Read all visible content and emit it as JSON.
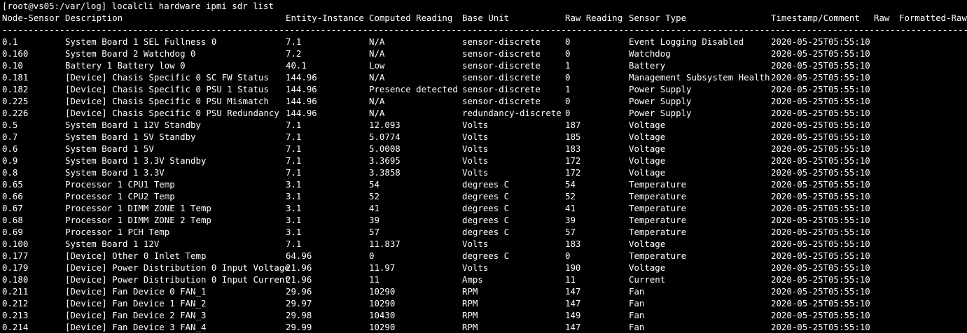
{
  "terminal": {
    "prompt": "[root@vs05:/var/log] localcli hardware ipmi sdr list",
    "headers": [
      "Node-Sensor",
      "Description",
      "Entity-Instance",
      "Computed Reading",
      "Base Unit",
      "Raw Reading",
      "Sensor Type",
      "Timestamp/Comment",
      "Raw",
      "Formatted-Raw"
    ],
    "separator": "----------------------------------------------------------------------------------------------------------------------------------------------------------------------------------------------------------------------------------------------------------",
    "rows": [
      [
        "0.1",
        "System Board 1 SEL Fullness 0",
        "7.1",
        "N/A",
        "sensor-discrete",
        "0",
        "Event Logging Disabled",
        "2020-05-25T05:55:10",
        "",
        ""
      ],
      [
        "0.160",
        "System Board 2 Watchdog 0",
        "7.2",
        "N/A",
        "sensor-discrete",
        "0",
        "Watchdog",
        "2020-05-25T05:55:10",
        "",
        ""
      ],
      [
        "0.10",
        "Battery 1 Battery low 0",
        "40.1",
        "Low",
        "sensor-discrete",
        "1",
        "Battery",
        "2020-05-25T05:55:10",
        "",
        ""
      ],
      [
        "0.181",
        "[Device] Chasis Specific 0 SC FW Status",
        "144.96",
        "N/A",
        "sensor-discrete",
        "0",
        "Management Subsystem Health",
        "2020-05-25T05:55:10",
        "",
        ""
      ],
      [
        "0.182",
        "[Device] Chasis Specific 0 PSU 1 Status",
        "144.96",
        "Presence detected",
        "sensor-discrete",
        "1",
        "Power Supply",
        "2020-05-25T05:55:10",
        "",
        ""
      ],
      [
        "0.225",
        "[Device] Chasis Specific 0 PSU Mismatch",
        "144.96",
        "N/A",
        "sensor-discrete",
        "0",
        "Power Supply",
        "2020-05-25T05:55:10",
        "",
        ""
      ],
      [
        "0.226",
        "[Device] Chasis Specific 0 PSU Redundancy",
        "144.96",
        "N/A",
        "redundancy-discrete",
        "0",
        "Power Supply",
        "2020-05-25T05:55:10",
        "",
        ""
      ],
      [
        "0.5",
        "System Board 1 12V Standby",
        "7.1",
        "12.093",
        "Volts",
        "187",
        "Voltage",
        "2020-05-25T05:55:10",
        "",
        ""
      ],
      [
        "0.7",
        "System Board 1 5V Standby",
        "7.1",
        "5.0774",
        "Volts",
        "185",
        "Voltage",
        "2020-05-25T05:55:10",
        "",
        ""
      ],
      [
        "0.6",
        "System Board 1 5V",
        "7.1",
        "5.0008",
        "Volts",
        "183",
        "Voltage",
        "2020-05-25T05:55:10",
        "",
        ""
      ],
      [
        "0.9",
        "System Board 1 3.3V Standby",
        "7.1",
        "3.3695",
        "Volts",
        "172",
        "Voltage",
        "2020-05-25T05:55:10",
        "",
        ""
      ],
      [
        "0.8",
        "System Board 1 3.3V",
        "7.1",
        "3.3858",
        "Volts",
        "172",
        "Voltage",
        "2020-05-25T05:55:10",
        "",
        ""
      ],
      [
        "0.65",
        "Processor 1 CPU1 Temp",
        "3.1",
        "54",
        "degrees C",
        "54",
        "Temperature",
        "2020-05-25T05:55:10",
        "",
        ""
      ],
      [
        "0.66",
        "Processor 1 CPU2 Temp",
        "3.1",
        "52",
        "degrees C",
        "52",
        "Temperature",
        "2020-05-25T05:55:10",
        "",
        ""
      ],
      [
        "0.67",
        "Processor 1 DIMM ZONE 1 Temp",
        "3.1",
        "41",
        "degrees C",
        "41",
        "Temperature",
        "2020-05-25T05:55:10",
        "",
        ""
      ],
      [
        "0.68",
        "Processor 1 DIMM ZONE 2 Temp",
        "3.1",
        "39",
        "degrees C",
        "39",
        "Temperature",
        "2020-05-25T05:55:10",
        "",
        ""
      ],
      [
        "0.69",
        "Processor 1 PCH Temp",
        "3.1",
        "57",
        "degrees C",
        "57",
        "Temperature",
        "2020-05-25T05:55:10",
        "",
        ""
      ],
      [
        "0.100",
        "System Board 1 12V",
        "7.1",
        "11.837",
        "Volts",
        "183",
        "Voltage",
        "2020-05-25T05:55:10",
        "",
        ""
      ],
      [
        "0.177",
        "[Device] Other 0 Inlet Temp",
        "64.96",
        "0",
        "degrees C",
        "0",
        "Temperature",
        "2020-05-25T05:55:10",
        "",
        ""
      ],
      [
        "0.179",
        "[Device] Power Distribution 0 Input Voltage",
        "21.96",
        "11.97",
        "Volts",
        "190",
        "Voltage",
        "2020-05-25T05:55:10",
        "",
        ""
      ],
      [
        "0.180",
        "[Device] Power Distribution 0 Input Current",
        "21.96",
        "11",
        "Amps",
        "11",
        "Current",
        "2020-05-25T05:55:10",
        "",
        ""
      ],
      [
        "0.211",
        "[Device] Fan Device 0 FAN_1",
        "29.96",
        "10290",
        "RPM",
        "147",
        "Fan",
        "2020-05-25T05:55:10",
        "",
        ""
      ],
      [
        "0.212",
        "[Device] Fan Device 1 FAN_2",
        "29.97",
        "10290",
        "RPM",
        "147",
        "Fan",
        "2020-05-25T05:55:10",
        "",
        ""
      ],
      [
        "0.213",
        "[Device] Fan Device 2 FAN_3",
        "29.98",
        "10430",
        "RPM",
        "149",
        "Fan",
        "2020-05-25T05:55:10",
        "",
        ""
      ],
      [
        "0.214",
        "[Device] Fan Device 3 FAN_4",
        "29.99",
        "10290",
        "RPM",
        "147",
        "Fan",
        "2020-05-25T05:55:10",
        "",
        ""
      ]
    ]
  },
  "colors": {
    "background": "#000000",
    "text": "#ffffff"
  }
}
